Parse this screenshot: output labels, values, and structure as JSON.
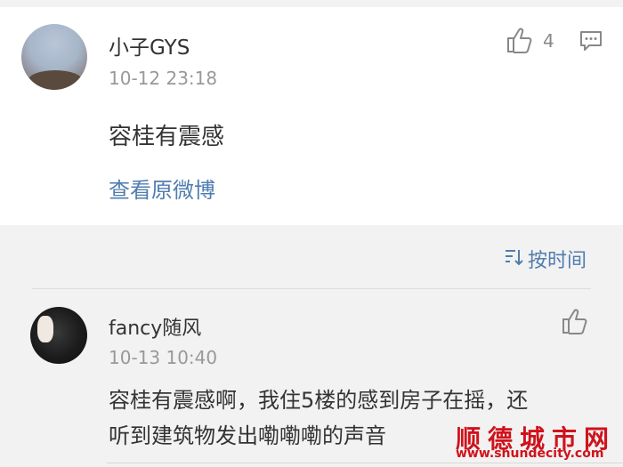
{
  "post": {
    "username": "小子GYS",
    "time": "10-12 23:18",
    "like_count": "4",
    "content": "容桂有震感",
    "view_original": "查看原微博",
    "icons": {
      "like": "thumbs-up-icon",
      "comment": "comment-icon"
    }
  },
  "sort": {
    "label": "按时间",
    "icon": "sort-icon"
  },
  "reply": {
    "username": "fancy随风",
    "time": "10-13 10:40",
    "content_line1": "容桂有震感啊，我住5楼的感到房子在摇，还",
    "content_line2": "听到建筑物发出嘞嘞嘞的声音",
    "icons": {
      "like": "thumbs-up-icon"
    }
  },
  "watermark": {
    "title": "顺德城市网",
    "url": "www.shundecity.com"
  },
  "colors": {
    "link": "#507daf",
    "secondary_text": "#999999",
    "watermark": "#d0121b",
    "background": "#f2f2f2"
  }
}
